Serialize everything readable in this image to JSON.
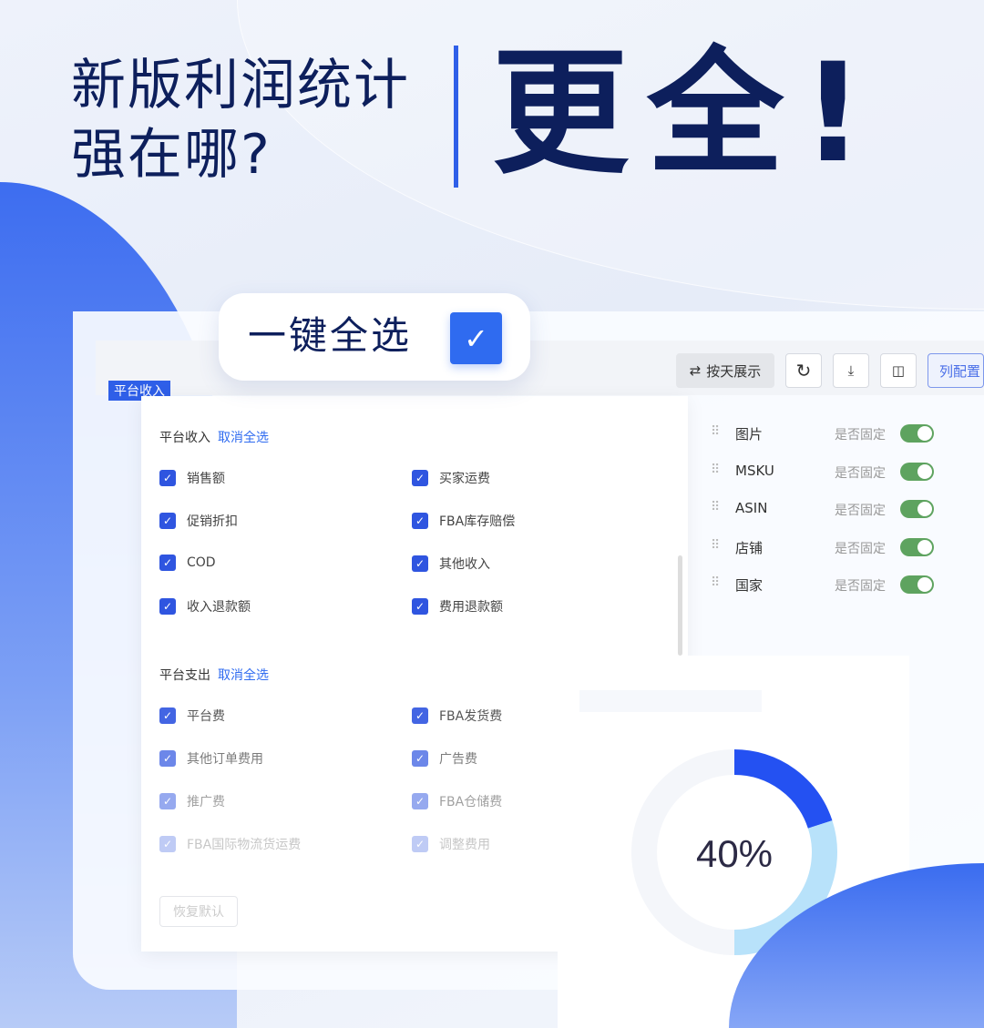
{
  "headline": {
    "line1": "新版利润统计",
    "line2": "强在哪?",
    "big": "更全!"
  },
  "pill": {
    "label": "一键全选",
    "checked": true
  },
  "toolbar": {
    "by_day": "按天展示",
    "refresh": "refresh-icon",
    "download": "download-icon",
    "columns": "columns-icon",
    "column_config": "列配置"
  },
  "table_tag": "平台收入",
  "panel": {
    "income": {
      "title": "平台收入",
      "deselect": "取消全选",
      "items": [
        "销售额",
        "买家运费",
        "促销折扣",
        "FBA库存赔偿",
        "COD",
        "其他收入",
        "收入退款额",
        "费用退款额"
      ]
    },
    "expense": {
      "title": "平台支出",
      "deselect": "取消全选",
      "items": [
        "平台费",
        "FBA发货费",
        "其他订单费用",
        "广告费",
        "推广费",
        "FBA仓储费",
        "FBA国际物流货运费",
        "调整费用"
      ]
    },
    "reset": "恢复默认"
  },
  "columns": {
    "fixed_label": "是否固定",
    "items": [
      {
        "name": "图片",
        "fixed": true
      },
      {
        "name": "MSKU",
        "fixed": true
      },
      {
        "name": "ASIN",
        "fixed": true
      },
      {
        "name": "店铺",
        "fixed": true
      },
      {
        "name": "国家",
        "fixed": true
      }
    ]
  },
  "donut": {
    "label": "40%",
    "segments": [
      {
        "fraction": 0.2,
        "color": "#2451f2"
      },
      {
        "fraction": 0.3,
        "color": "#b8e2fa"
      }
    ],
    "track": "#f4f6fa"
  },
  "colors": {
    "navy": "#0d1f5c",
    "accent": "#2f6bf0",
    "toggle": "#5ea35f"
  }
}
